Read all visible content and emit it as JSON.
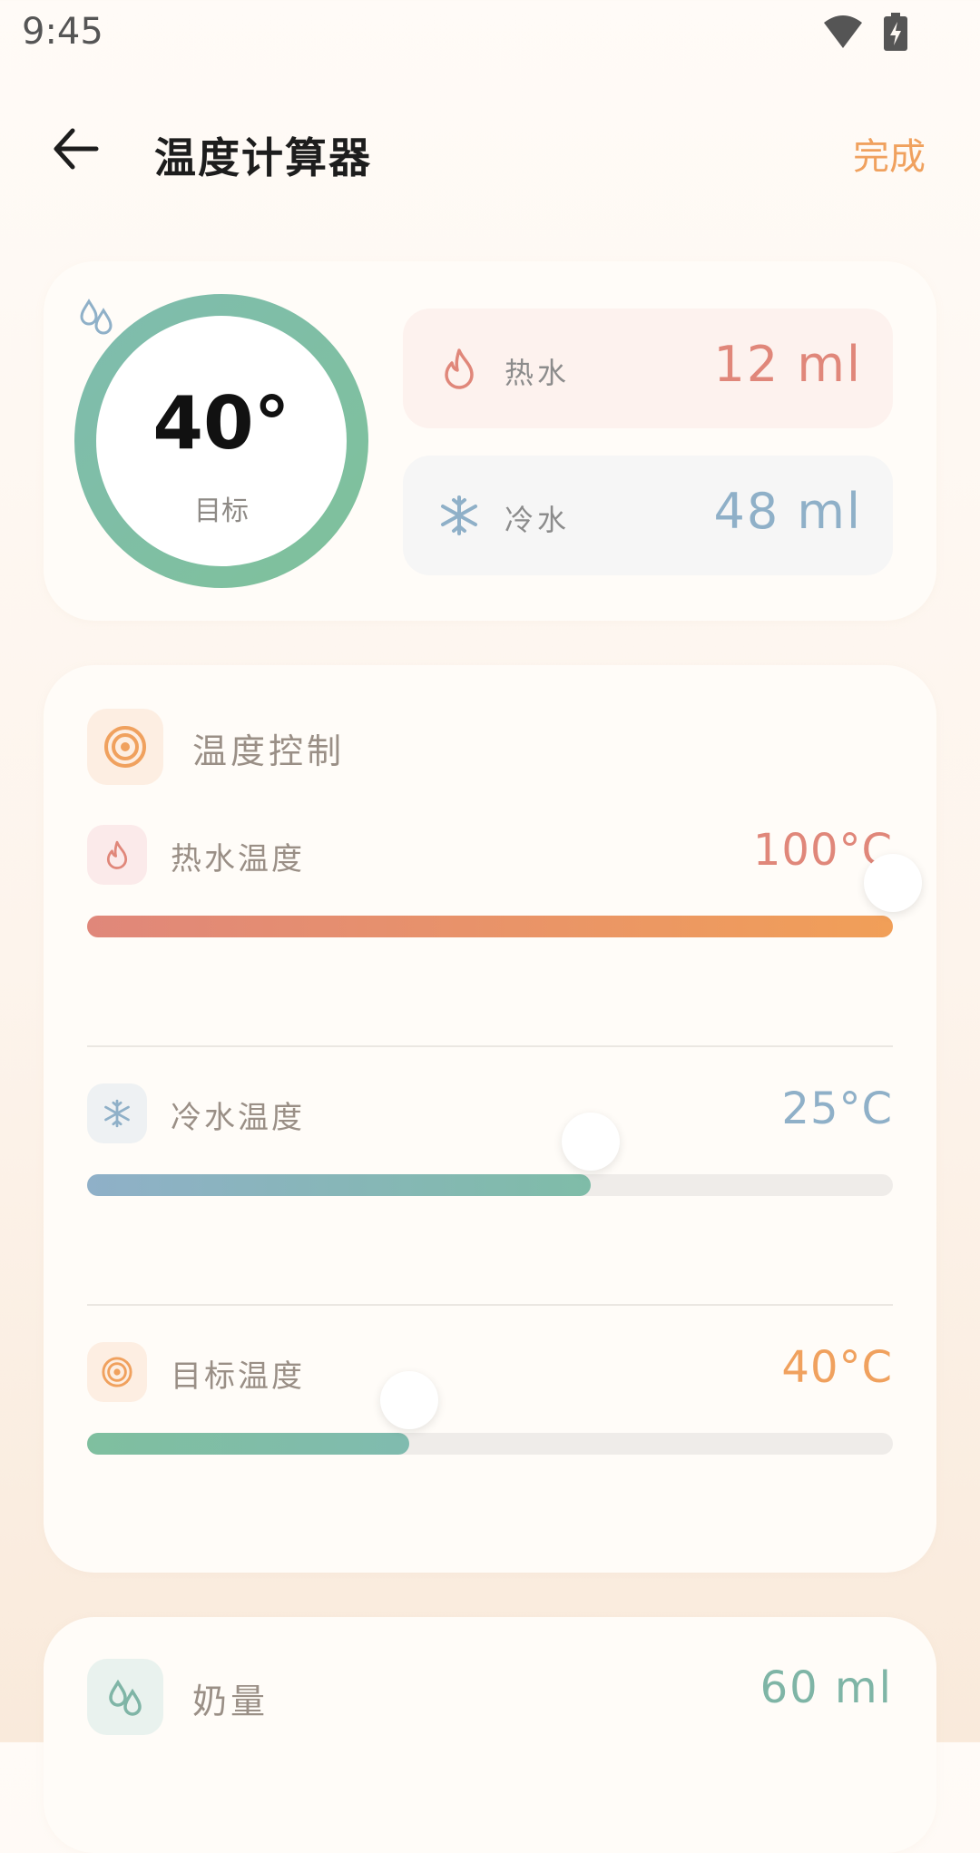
{
  "status": {
    "time": "9:45"
  },
  "header": {
    "title": "温度计算器",
    "done_label": "完成"
  },
  "summary": {
    "target_value": "40°",
    "target_label": "目标",
    "hot": {
      "label": "热水",
      "value": "12 ml"
    },
    "cold": {
      "label": "冷水",
      "value": "48 ml"
    }
  },
  "control": {
    "title": "温度控制",
    "sliders": [
      {
        "label": "热水温度",
        "value": "100°C",
        "level": 1.0,
        "color": "#e0877a"
      },
      {
        "label": "冷水温度",
        "value": "25°C",
        "level": 0.625,
        "color": "#8fb0c8"
      },
      {
        "label": "目标温度",
        "value": "40°C",
        "level": 0.4,
        "color": "#f0a15e"
      }
    ]
  },
  "milk": {
    "label": "奶量",
    "value": "60 ml"
  },
  "colors": {
    "accent": "#f0a15e",
    "hot": "#e0877a",
    "cold": "#8fb0c8",
    "ring": "#7fbf9f"
  }
}
